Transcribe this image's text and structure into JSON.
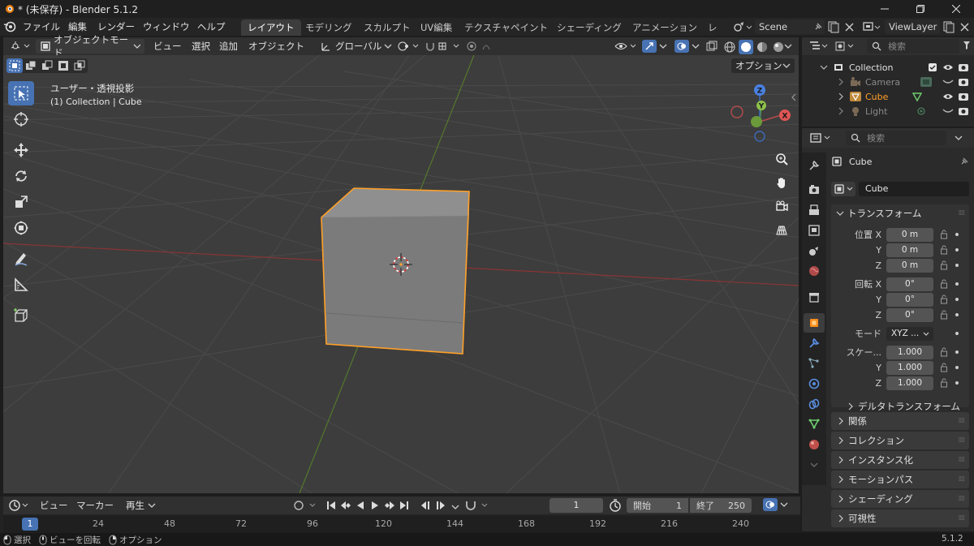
{
  "titlebar": {
    "title": "* (未保存) - Blender 5.1.2"
  },
  "menubar": {
    "menus": [
      "ファイル",
      "編集",
      "レンダー",
      "ウィンドウ",
      "ヘルプ"
    ],
    "workspaces": [
      {
        "label": "レイアウト",
        "active": true
      },
      {
        "label": "モデリング"
      },
      {
        "label": "スカルプト"
      },
      {
        "label": "UV編集"
      },
      {
        "label": "テクスチャペイント"
      },
      {
        "label": "シェーディング"
      },
      {
        "label": "アニメーション"
      },
      {
        "label": "レン"
      }
    ],
    "scene": "Scene",
    "view_layer": "ViewLayer"
  },
  "viewport_header": {
    "mode": "オブジェクトモード",
    "menus": [
      "ビュー",
      "選択",
      "追加",
      "オブジェクト"
    ],
    "orientation": "グローバル",
    "options": "オプション"
  },
  "viewport": {
    "view_name": "ユーザー・透視投影",
    "object_info": "(1) Collection | Cube",
    "gizmo": {
      "z": "Z",
      "y": "Y",
      "x": "X"
    },
    "accent": "#4772b3",
    "selection_color": "#ffa028"
  },
  "outliner": {
    "search_placeholder": "検索",
    "collection": "Collection",
    "items": [
      {
        "name": "Camera",
        "icon": "camera-icon",
        "active": false
      },
      {
        "name": "Cube",
        "icon": "mesh-icon",
        "active": true
      },
      {
        "name": "Light",
        "icon": "light-icon",
        "active": false
      }
    ]
  },
  "properties": {
    "search_placeholder": "検索",
    "object_name": "Cube",
    "object_field": "Cube",
    "transform": {
      "title": "トランスフォーム",
      "location_label": "位置 X",
      "location": [
        "0 m",
        "0 m",
        "0 m"
      ],
      "rotation_label": "回転 X",
      "rotation": [
        "0°",
        "0°",
        "0°"
      ],
      "mode_label": "モード",
      "mode_value": "XYZ ...",
      "scale_label": "スケー...",
      "scale": [
        "1.000",
        "1.000",
        "1.000"
      ],
      "axis_y": "Y",
      "axis_z": "Z",
      "delta": "デルタトランスフォーム"
    },
    "panels": [
      "関係",
      "コレクション",
      "インスタンス化",
      "モーションパス",
      "シェーディング",
      "可視性"
    ]
  },
  "timeline": {
    "menus": [
      "ビュー",
      "マーカー"
    ],
    "playback": "再生",
    "current_frame": "1",
    "start_label": "開始",
    "start": "1",
    "end_label": "終了",
    "end": "250",
    "ruler": [
      "1",
      "24",
      "48",
      "72",
      "96",
      "120",
      "144",
      "168",
      "192",
      "216",
      "240"
    ]
  },
  "statusbar": {
    "items": [
      "選択",
      "ビューを回転",
      "オプション"
    ],
    "version": "5.1.2"
  }
}
